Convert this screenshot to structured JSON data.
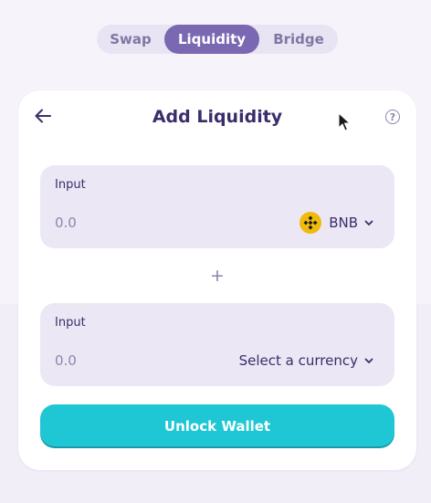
{
  "tabs": [
    {
      "label": "Swap",
      "active": false
    },
    {
      "label": "Liquidity",
      "active": true
    },
    {
      "label": "Bridge",
      "active": false
    }
  ],
  "card": {
    "title": "Add Liquidity",
    "back_icon": "arrow-left-icon",
    "help_icon": "question-circle-icon",
    "help_glyph": "?"
  },
  "input_a": {
    "label": "Input",
    "placeholder": "0.0",
    "currency": "BNB",
    "currency_icon": "bnb-logo-icon"
  },
  "separator": "+",
  "input_b": {
    "label": "Input",
    "placeholder": "0.0",
    "currency": "Select a currency"
  },
  "unlock_button": "Unlock Wallet",
  "colors": {
    "accent": "#7b68b3",
    "button": "#1fc7d4",
    "text": "#3b2d6b",
    "panel": "#ebe7f4",
    "bnb": "#f0b90b"
  }
}
